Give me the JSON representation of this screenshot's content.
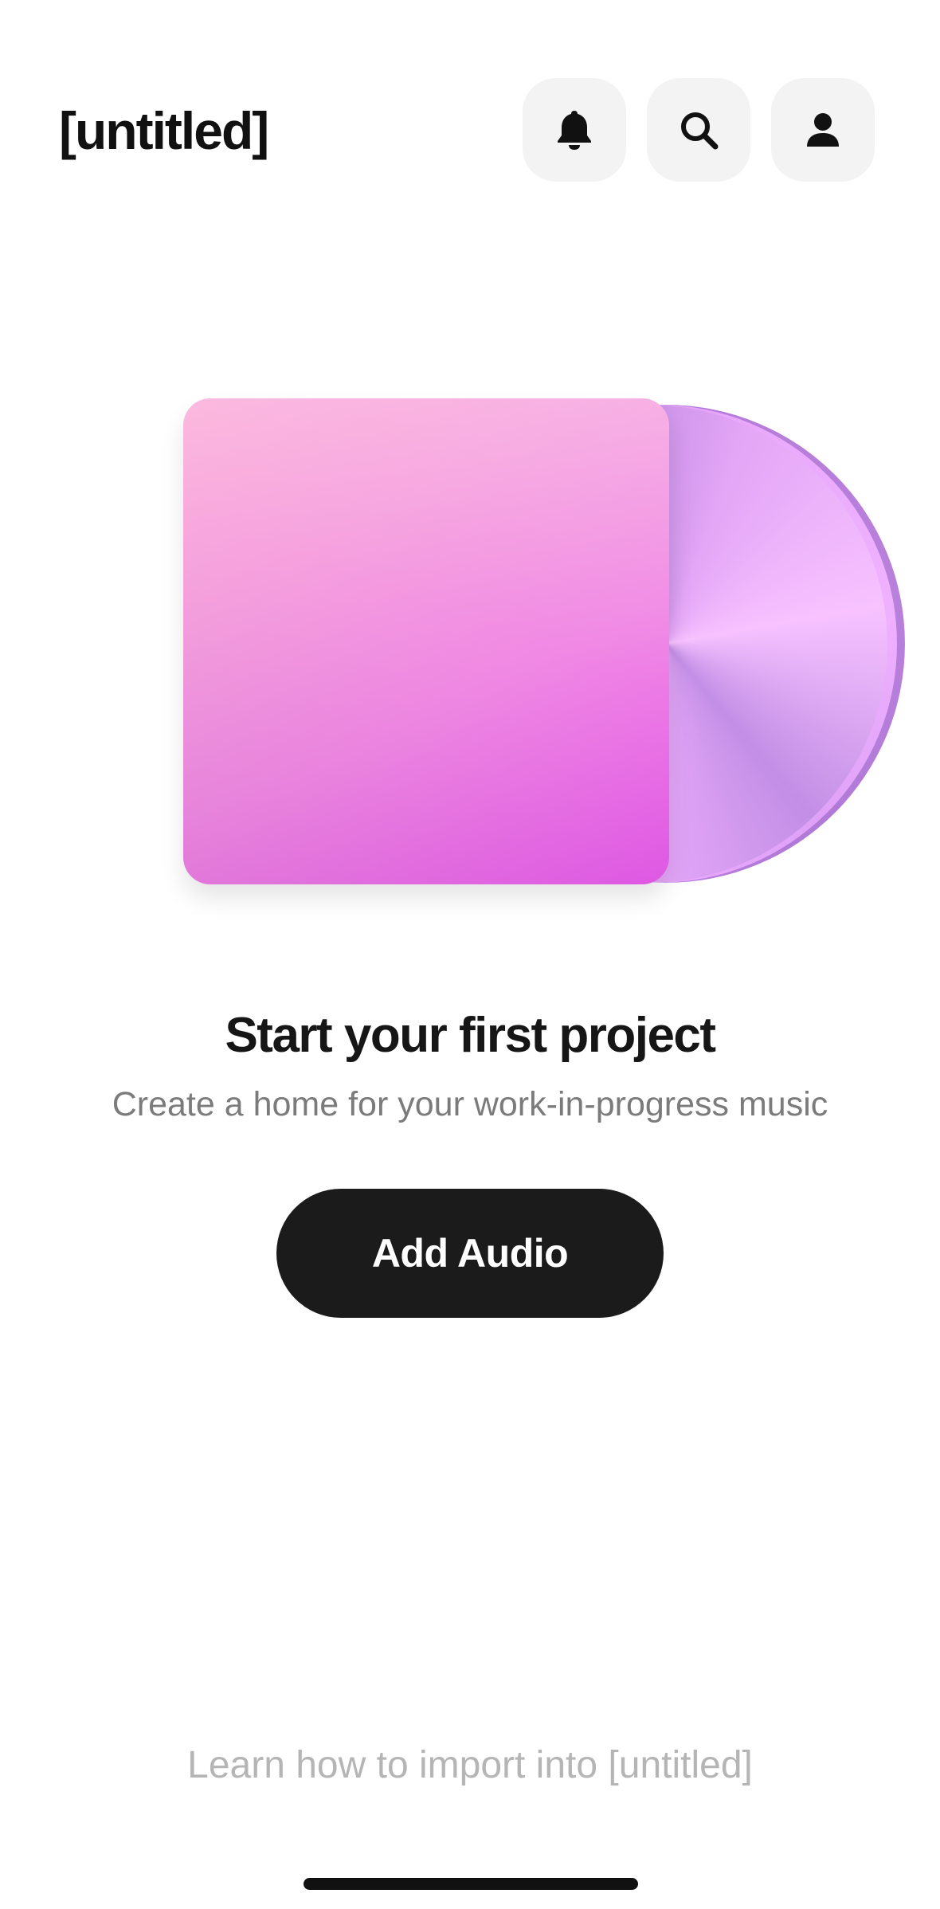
{
  "header": {
    "app_title": "[untitled]",
    "actions": [
      {
        "name": "notifications",
        "icon": "bell-icon"
      },
      {
        "name": "search",
        "icon": "search-icon"
      },
      {
        "name": "profile",
        "icon": "user-icon"
      }
    ]
  },
  "empty_state": {
    "artwork": "album-cover-with-vinyl",
    "title": "Start your first project",
    "subtitle": "Create a home for your work-in-progress music",
    "primary_button_label": "Add Audio"
  },
  "footer": {
    "help_link_label": "Learn how to import into [untitled]"
  },
  "colors": {
    "button_background": "#1b1b1b",
    "icon_button_background": "#f3f3f3",
    "cover_gradient_start": "#fcb4dc",
    "cover_gradient_end": "#e45ae9",
    "subtitle_text": "#7b7b7b",
    "link_text": "#b5b5b5"
  }
}
